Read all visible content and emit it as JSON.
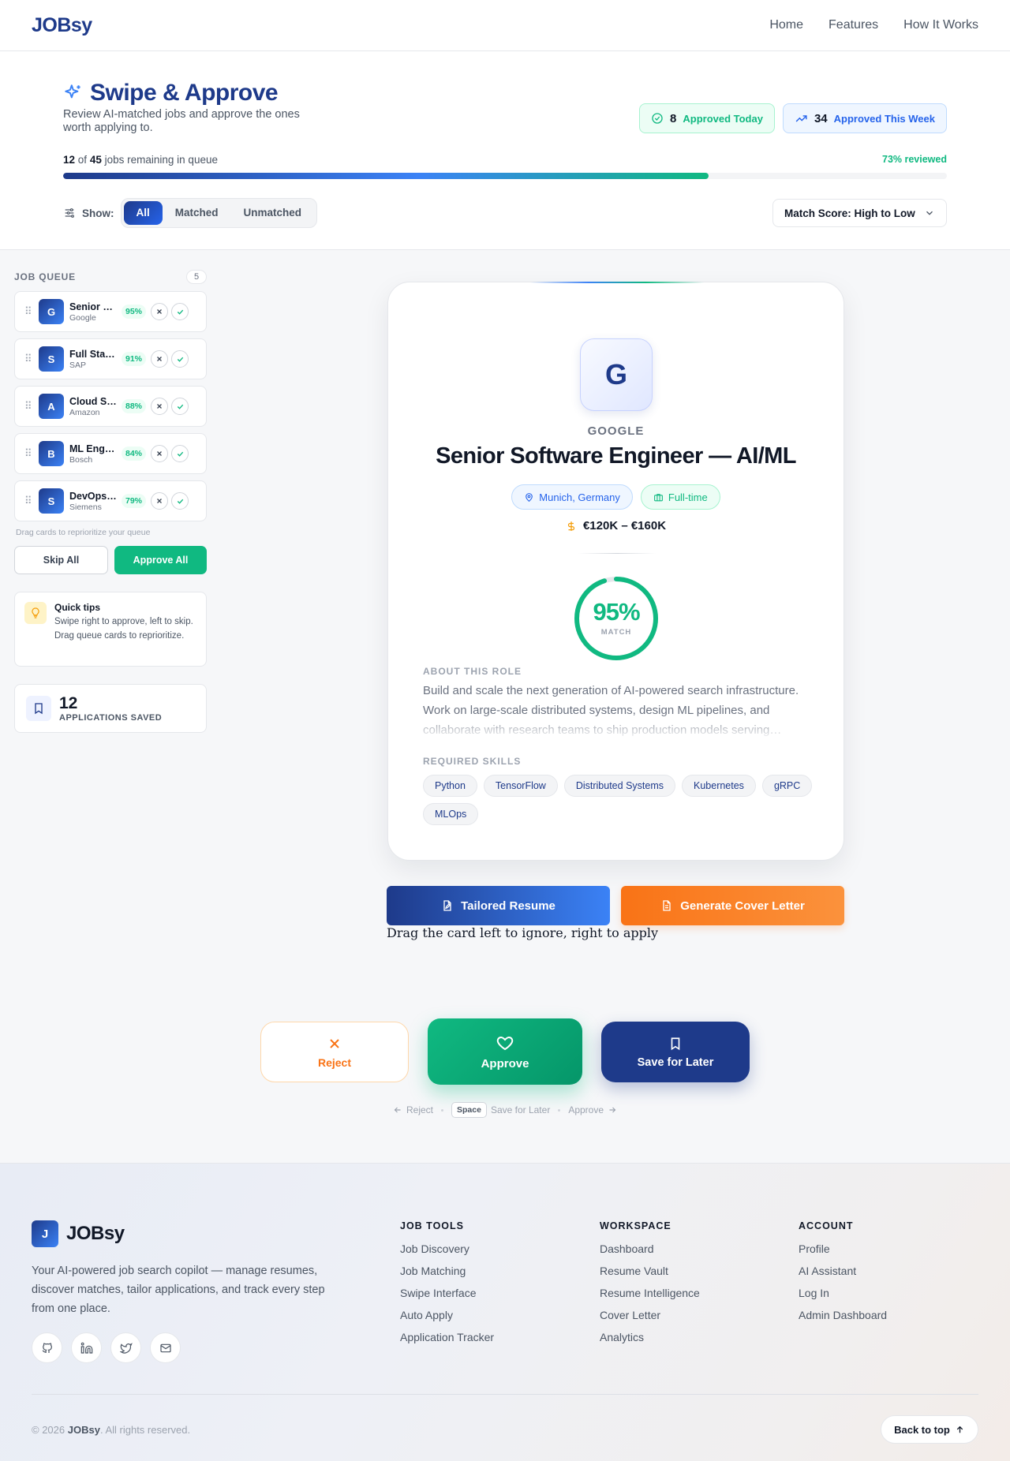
{
  "nav": {
    "logo": "JOBsy",
    "links": [
      "Home",
      "Features",
      "How It Works"
    ]
  },
  "header": {
    "title": "Swipe & Approve",
    "subtitle": "Review AI-matched jobs and approve the ones worth applying to.",
    "stats": [
      {
        "value": "8",
        "label": "Approved Today"
      },
      {
        "value": "34",
        "label": "Approved This Week"
      }
    ],
    "queue": {
      "remaining": "12",
      "of_word": "of",
      "total": "45",
      "suffix": "jobs remaining in queue",
      "reviewed_label": "73% reviewed",
      "progress": 0.73
    },
    "filter": {
      "show_label": "Show:",
      "options": [
        "All",
        "Matched",
        "Unmatched"
      ],
      "active": "All"
    },
    "sort": {
      "value": "Match Score: High to Low"
    }
  },
  "sidebar": {
    "heading": "JOB QUEUE",
    "count": "5",
    "items": [
      {
        "initial": "G",
        "title": "Senior Software Engineer — AI/ML",
        "company": "Google",
        "score": "95%"
      },
      {
        "initial": "S",
        "title": "Full Stack Developer",
        "company": "SAP",
        "score": "91%"
      },
      {
        "initial": "A",
        "title": "Cloud Solutions Architect",
        "company": "Amazon",
        "score": "88%"
      },
      {
        "initial": "B",
        "title": "ML Engineer",
        "company": "Bosch",
        "score": "84%"
      },
      {
        "initial": "S",
        "title": "DevOps Engineer",
        "company": "Siemens",
        "score": "79%"
      }
    ],
    "hint": "Drag cards to reprioritize your queue",
    "skip_all": "Skip All",
    "approve_all": "Approve All",
    "tips": {
      "title": "Quick tips",
      "text": "Swipe right to approve, left to skip. Drag queue cards to reprioritize."
    },
    "saved": {
      "value": "12",
      "label": "APPLICATIONS SAVED"
    }
  },
  "card": {
    "initial": "G",
    "company": "GOOGLE",
    "title": "Senior Software Engineer — AI/ML",
    "location": "Munich, Germany",
    "type": "Full-time",
    "salary": "€120K – €160K",
    "match": {
      "value": "95%",
      "fraction": 0.95,
      "label": "MATCH"
    },
    "about_label": "ABOUT THIS ROLE",
    "about": "Build and scale the next generation of AI-powered search infrastructure. Work on large-scale distributed systems, design ML pipelines, and collaborate with research teams to ship production models serving…",
    "skills_label": "REQUIRED SKILLS",
    "skills": [
      "Python",
      "TensorFlow",
      "Distributed Systems",
      "Kubernetes",
      "gRPC",
      "MLOps"
    ]
  },
  "actions": {
    "tailored_resume": "Tailored Resume",
    "cover_letter": "Generate Cover Letter",
    "drag_hint": "Drag the card left to ignore, right to apply",
    "reject": "Reject",
    "approve": "Approve",
    "save": "Save for Later",
    "kbd": {
      "reject": "Reject",
      "space": "Space",
      "save": "Save for Later",
      "approve": "Approve"
    }
  },
  "footer": {
    "logo_initial": "J",
    "logo": "JOBsy",
    "description": "Your AI-powered job search copilot — manage resumes, discover matches, tailor applications, and track every step from one place.",
    "columns": [
      {
        "title": "JOB TOOLS",
        "links": [
          "Job Discovery",
          "Job Matching",
          "Swipe Interface",
          "Auto Apply",
          "Application Tracker"
        ]
      },
      {
        "title": "WORKSPACE",
        "links": [
          "Dashboard",
          "Resume Vault",
          "Resume Intelligence",
          "Cover Letter",
          "Analytics"
        ]
      },
      {
        "title": "ACCOUNT",
        "links": [
          "Profile",
          "AI Assistant",
          "Log In",
          "Admin Dashboard"
        ]
      }
    ],
    "copyright_prefix": "© 2026",
    "copyright_brand": "JOBsy",
    "copyright_suffix": ". All rights reserved.",
    "back_to_top": "Back to top"
  },
  "colors": {
    "primary": "#1e3a8a",
    "accent": "#3b82f6",
    "success": "#10b981",
    "warning": "#f97316"
  }
}
